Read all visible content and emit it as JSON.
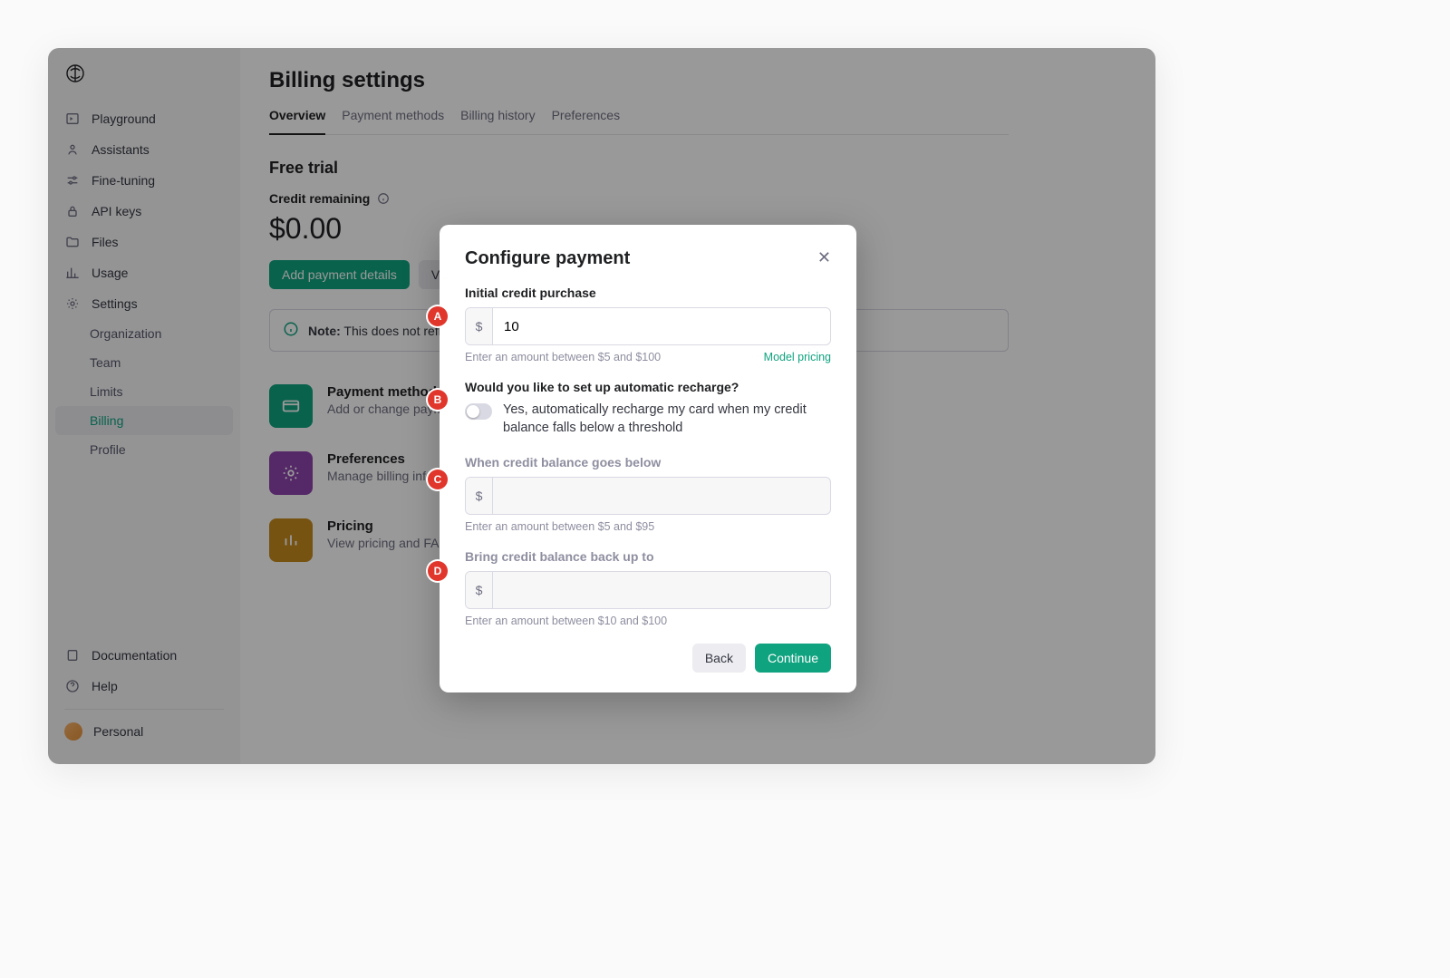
{
  "sidebar": {
    "items": [
      {
        "label": "Playground"
      },
      {
        "label": "Assistants"
      },
      {
        "label": "Fine-tuning"
      },
      {
        "label": "API keys"
      },
      {
        "label": "Files"
      },
      {
        "label": "Usage"
      },
      {
        "label": "Settings"
      }
    ],
    "sub_items": [
      {
        "label": "Organization"
      },
      {
        "label": "Team"
      },
      {
        "label": "Limits"
      },
      {
        "label": "Billing"
      },
      {
        "label": "Profile"
      }
    ],
    "footer": {
      "documentation": "Documentation",
      "help": "Help",
      "account": "Personal"
    }
  },
  "page": {
    "title": "Billing settings",
    "tabs": [
      "Overview",
      "Payment methods",
      "Billing history",
      "Preferences"
    ],
    "active_tab": 0,
    "section_heading": "Free trial",
    "credit_label": "Credit remaining",
    "credit_amount": "$0.00",
    "buttons": {
      "add_payment": "Add payment details",
      "view_usage": "View usage"
    },
    "note_bold": "Note:",
    "note_text": " This does not reflect the status of your ChatGPT account.",
    "cards": [
      {
        "title": "Payment methods",
        "sub": "Add or change payment method"
      },
      {
        "title": "Preferences",
        "sub": "Manage billing information"
      },
      {
        "title": "Pricing",
        "sub": "View pricing and FAQs"
      }
    ]
  },
  "modal": {
    "title": "Configure payment",
    "initial_label": "Initial credit purchase",
    "currency_symbol": "$",
    "initial_value": "10",
    "initial_hint": "Enter an amount between $5 and $100",
    "pricing_link": "Model pricing",
    "auto_label": "Would you like to set up automatic recharge?",
    "auto_toggle_text": "Yes, automatically recharge my card when my credit balance falls below a threshold",
    "below_label": "When credit balance goes below",
    "below_hint": "Enter an amount between $5 and $95",
    "upto_label": "Bring credit balance back up to",
    "upto_hint": "Enter an amount between $10 and $100",
    "back_label": "Back",
    "continue_label": "Continue"
  },
  "markers": [
    "A",
    "B",
    "C",
    "D"
  ]
}
